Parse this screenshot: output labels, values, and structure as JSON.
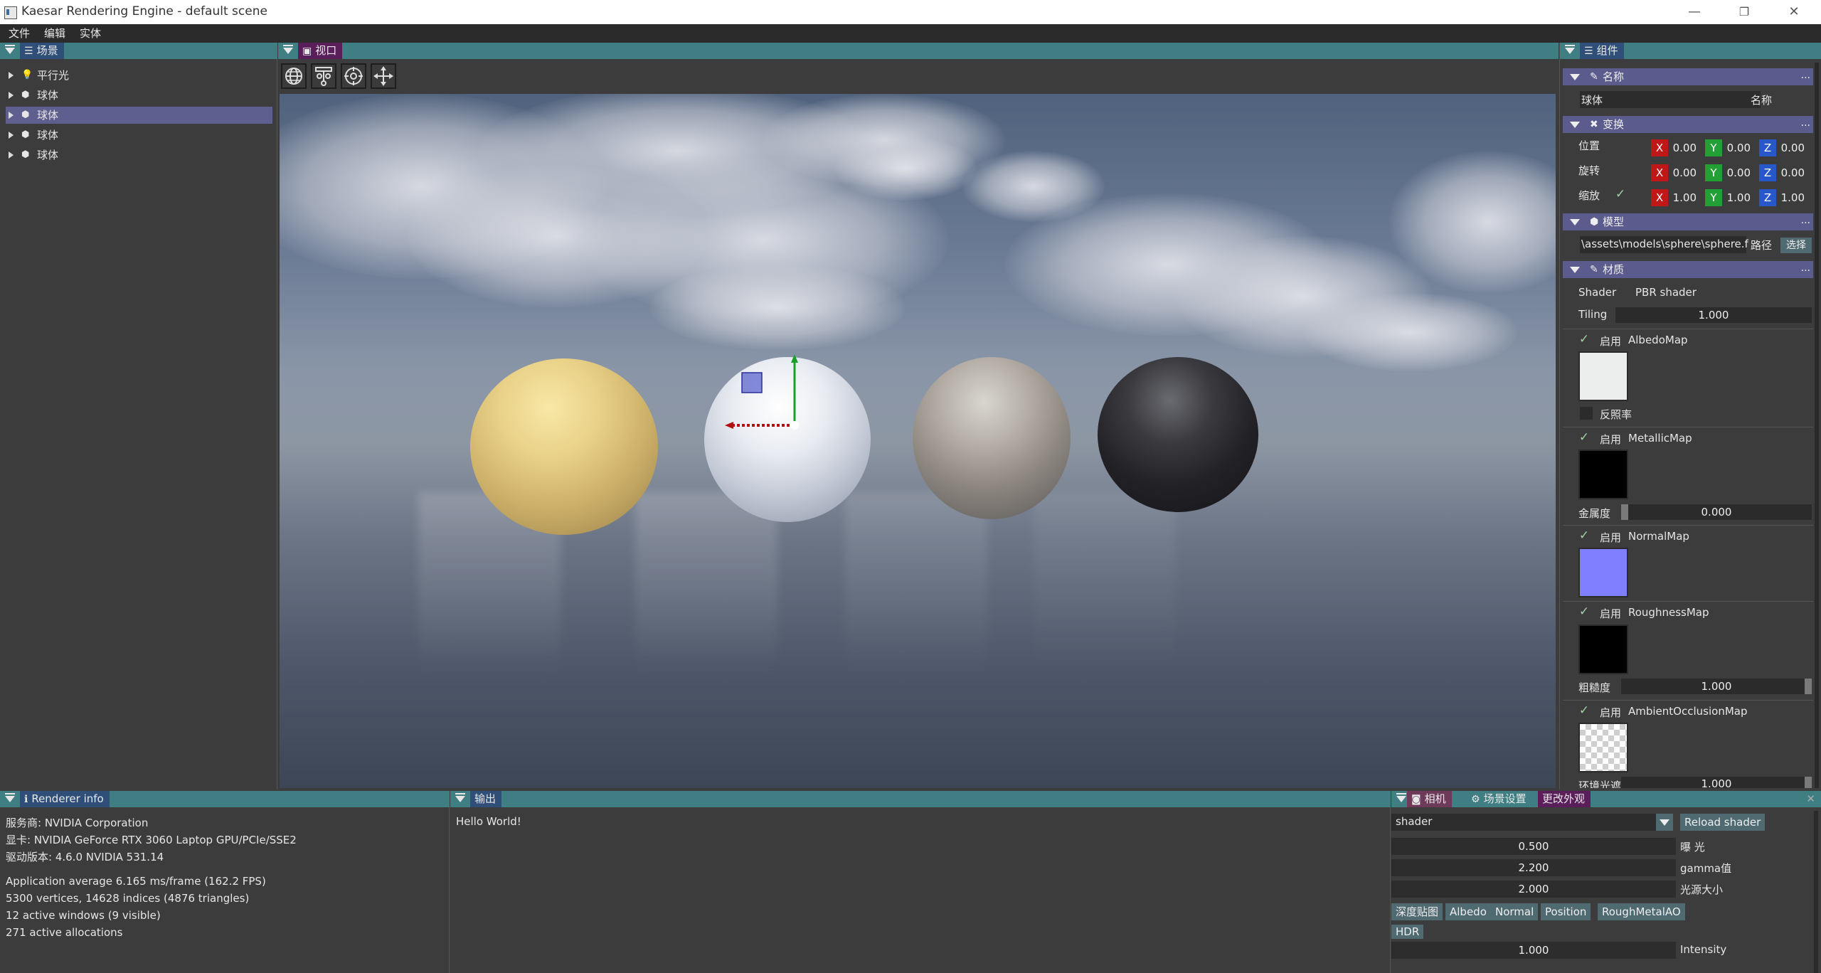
{
  "window": {
    "title": "Kaesar Rendering Engine - default scene",
    "controls": {
      "minimize": "—",
      "maximize": "❐",
      "close": "✕"
    }
  },
  "menubar": {
    "items": [
      "文件",
      "编辑",
      "实体"
    ]
  },
  "scene_panel": {
    "title": "场景",
    "items": [
      {
        "label": "平行光",
        "icon": "lightbulb-icon",
        "selected": false
      },
      {
        "label": "球体",
        "icon": "cube-icon",
        "selected": false
      },
      {
        "label": "球体",
        "icon": "cube-icon",
        "selected": true
      },
      {
        "label": "球体",
        "icon": "cube-icon",
        "selected": false
      },
      {
        "label": "球体",
        "icon": "cube-icon",
        "selected": false
      }
    ]
  },
  "viewport": {
    "tab": "视口",
    "tools": [
      "globe-icon",
      "hierarchy-icon",
      "target-icon",
      "move-icon"
    ]
  },
  "components": {
    "title": "组件",
    "name_section": {
      "title": "名称",
      "value": "球体",
      "label": "名称",
      "more": "..."
    },
    "transform_section": {
      "title": "变换",
      "more": "...",
      "rows": [
        {
          "label": "位置",
          "x": "0.00",
          "y": "0.00",
          "z": "0.00"
        },
        {
          "label": "旋转",
          "x": "0.00",
          "y": "0.00",
          "z": "0.00"
        },
        {
          "label": "缩放",
          "x": "1.00",
          "y": "1.00",
          "z": "1.00",
          "locked": true
        }
      ],
      "axis_labels": {
        "x": "X",
        "y": "Y",
        "z": "Z"
      }
    },
    "model_section": {
      "title": "模型",
      "more": "...",
      "path": "\\assets\\models\\sphere\\sphere.fbx",
      "path_label": "路径",
      "select_button": "选择"
    },
    "material_section": {
      "title": "材质",
      "more": "...",
      "shader_label": "Shader",
      "shader_value": "PBR shader",
      "tiling_label": "Tiling",
      "tiling_value": "1.000",
      "enable_label": "启用",
      "maps": [
        {
          "name": "AlbedoMap",
          "color": "#eceeee",
          "sub_label": "反照率",
          "sub_value": ""
        },
        {
          "name": "MetallicMap",
          "color": "#000000",
          "sub_label": "金属度",
          "sub_value": "0.000"
        },
        {
          "name": "NormalMap",
          "color": "#7f7fff",
          "sub_label": "",
          "sub_value": ""
        },
        {
          "name": "RoughnessMap",
          "color": "#000000",
          "sub_label": "粗糙度",
          "sub_value": "1.000"
        },
        {
          "name": "AmbientOcclusionMap",
          "color": "checker",
          "sub_label": "环境光遮蔽",
          "sub_value": "1.000"
        }
      ]
    }
  },
  "renderer_info": {
    "title": "Renderer info",
    "lines": [
      "服务商: NVIDIA Corporation",
      "显卡: NVIDIA GeForce RTX 3060 Laptop GPU/PCIe/SSE2",
      "驱动版本: 4.6.0 NVIDIA 531.14",
      "",
      "Application average 6.165 ms/frame (162.2 FPS)",
      "5300 vertices, 14628 indices (4876 triangles)",
      "12 active windows (9 visible)",
      "271 active allocations"
    ]
  },
  "output": {
    "title": "输出",
    "text": "Hello World!"
  },
  "camera_panel": {
    "tabs": [
      "相机",
      "场景设置",
      "更改外观"
    ],
    "shader_field": "shader",
    "reload_button": "Reload shader",
    "params": [
      {
        "value": "0.500",
        "label": "曝 光"
      },
      {
        "value": "2.200",
        "label": "gamma值"
      },
      {
        "value": "2.000",
        "label": "光源大小"
      }
    ],
    "buffer_buttons": [
      "深度贴图",
      "Albedo",
      "Normal",
      "Position",
      "RoughMetalAO",
      "HDR"
    ],
    "intensity": {
      "value": "1.000",
      "label": "Intensity"
    },
    "close": "✕"
  },
  "colors": {
    "panel_header": "#3f7e82",
    "section_header": "#5b5b8e",
    "selection": "#5f5f8f",
    "axis_x": "#c01818",
    "axis_y": "#22a035",
    "axis_z": "#2857c9"
  }
}
